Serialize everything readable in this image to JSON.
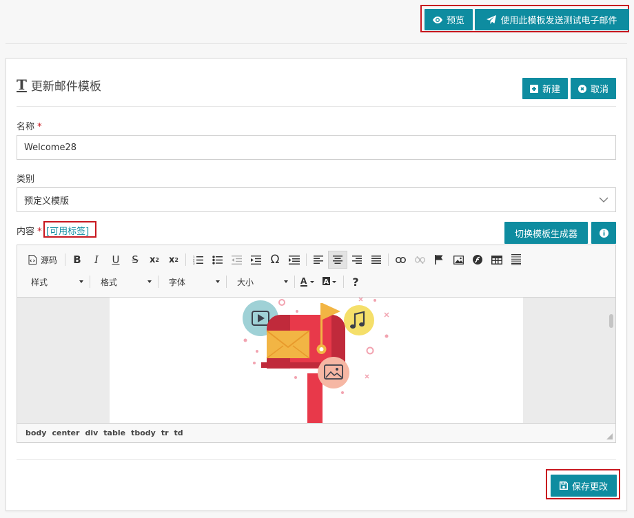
{
  "top_actions": {
    "preview_label": "预览",
    "send_test_label": "使用此模板发送测试电子邮件"
  },
  "panel": {
    "title": "更新邮件模板",
    "new_label": "新建",
    "cancel_label": "取消"
  },
  "form": {
    "name_label": "名称",
    "required_mark": "*",
    "name_value": "Welcome28",
    "category_label": "类别",
    "category_value": "预定义模版",
    "content_label": "内容",
    "tags_link": "[可用标签]",
    "toggle_builder_label": "切换模板生成器",
    "info_icon": "info-circle-icon"
  },
  "editor": {
    "source_label": "源码",
    "style_label": "样式",
    "format_label": "格式",
    "font_label": "字体",
    "size_label": "大小",
    "help_label": "?",
    "path": [
      "body",
      "center",
      "div",
      "table",
      "tbody",
      "tr",
      "td"
    ]
  },
  "footer": {
    "save_label": "保存更改"
  },
  "colors": {
    "accent": "#0e8ca0",
    "highlight_box": "#c8171e",
    "mailbox_red": "#e8394a",
    "envelope": "#f2b544"
  }
}
